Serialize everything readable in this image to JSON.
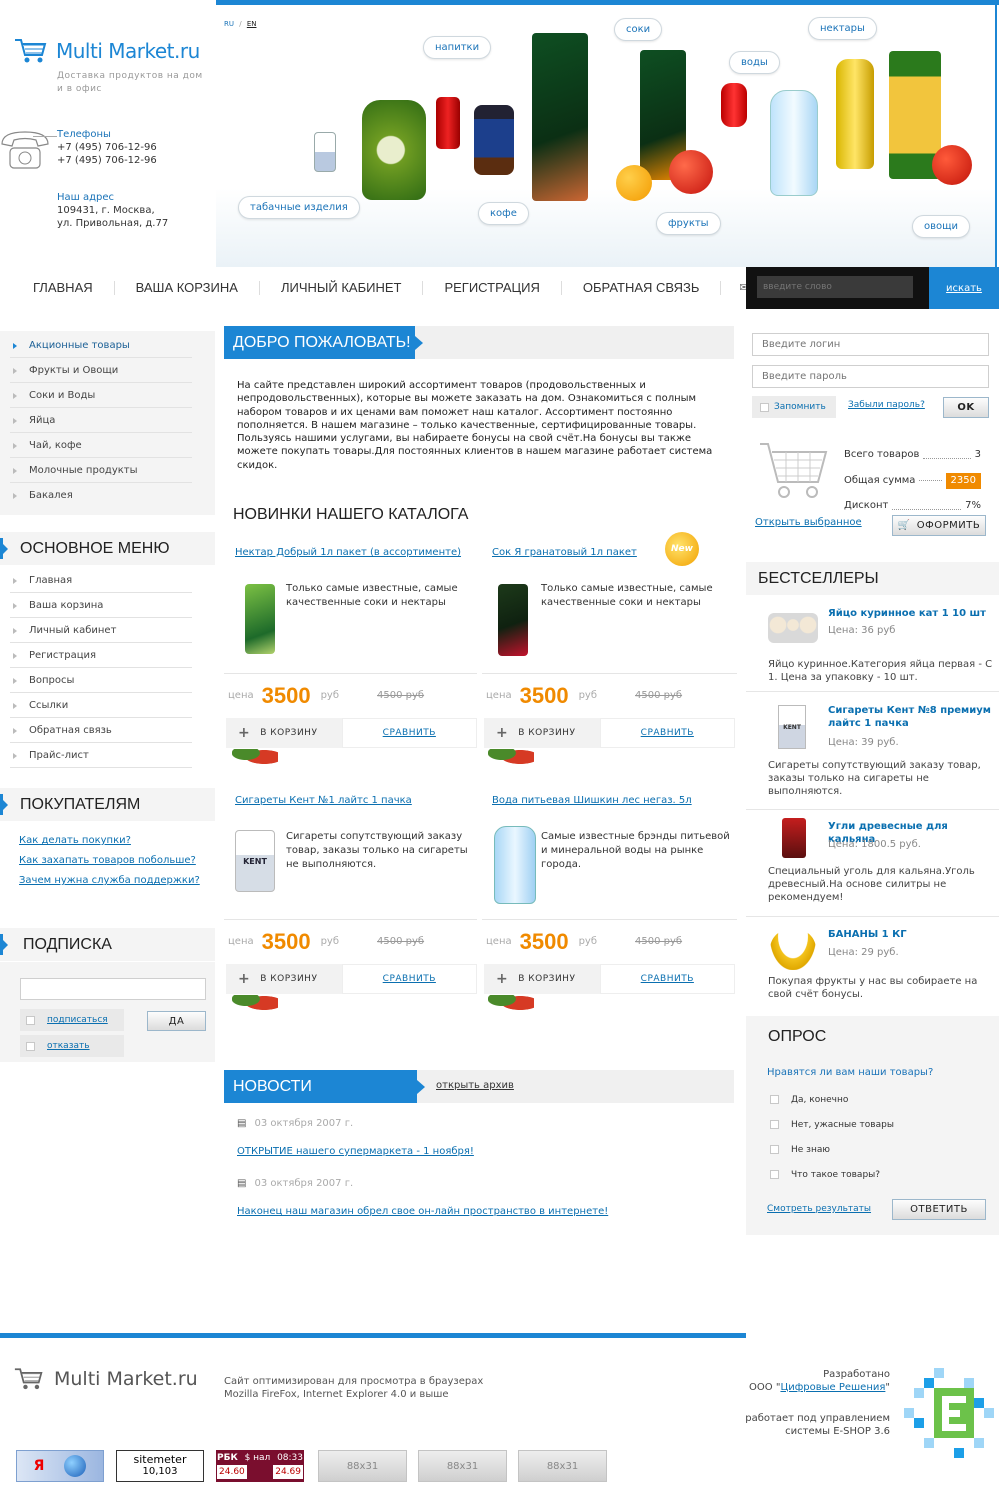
{
  "header": {
    "logo_text": "Multi Market.ru",
    "tagline": "Доставка продуктов на дом и в офис",
    "lang_ru": "RU",
    "lang_sep": "/",
    "lang_en": "EN",
    "phones_label": "Телефоны",
    "phone1": "+7 (495) 706-12-96",
    "phone2": "+7 (495) 706-12-96",
    "address_label": "Наш адрес",
    "address_line1": "109431, г. Москва,",
    "address_line2": "ул. Привольная, д.77"
  },
  "hero": {
    "labels": [
      "напитки",
      "соки",
      "воды",
      "нектары",
      "табачные изделия",
      "кофе",
      "фрукты",
      "овощи"
    ]
  },
  "nav": {
    "items": [
      "Главная",
      "Ваша корзина",
      "Личный кабинет",
      "Регистрация",
      "Обратная связь"
    ]
  },
  "search": {
    "placeholder": "введите слово",
    "button": "искать"
  },
  "promo_menu": {
    "items": [
      "Акционные товары",
      "Фрукты и Овощи",
      "Соки и Воды",
      "Яйца",
      "Чай, кофе",
      "Молочные продукты",
      "Бакалея"
    ]
  },
  "main_menu": {
    "title": "Основное меню",
    "items": [
      "Главная",
      "Ваша корзина",
      "Личный кабинет",
      "Регистрация",
      "Вопросы",
      "Ссылки",
      "Обратная связь",
      "Прайс-лист"
    ]
  },
  "buyers": {
    "title": "Покупателям",
    "links": [
      "Как делать покупки?",
      "Как захапать товаров побольше?",
      "Зачем нужна служба поддержки?"
    ]
  },
  "subscribe": {
    "title": "Подписка",
    "subscribe_label": "подписаться",
    "unsubscribe_label": "отказать",
    "button": "ДА"
  },
  "welcome": {
    "title": "Добро пожаловать!",
    "text": "На сайте представлен широкий ассортимент товаров (продовольственных и непродовольственных), которые вы можете заказать на дом. Ознакомиться с полным набором товаров и их ценами вам поможет наш каталог. Ассортимент постоянно пополняется. В нашем магазине – только качественные, сертифицированные товары. Пользуясь нашими услугами, вы набираете бонусы на свой счёт.На бонусы вы также можете покупать товары.Для постоянных клиентов в нашем магазине работает система скидок."
  },
  "catalog": {
    "title": "Новинки нашего каталога",
    "new_badge": "New",
    "price_label": "цена",
    "currency": "руб",
    "cart_label": "В КОРЗИНУ",
    "compare_label": "СРАВНИТЬ",
    "products": [
      {
        "name": "Нектар Добрый 1л пакет (в ассортименте)",
        "desc": "Только самые известные, самые качественные соки и нектары",
        "price": "3500",
        "old_price": "4500 руб"
      },
      {
        "name": "Сок Я гранатовый 1л пакет",
        "desc": "Только самые известные, самые качественные соки и нектары",
        "price": "3500",
        "old_price": "4500 руб"
      },
      {
        "name": "Сигареты Кент №1 лайтс 1 пачка",
        "desc": "Сигареты сопутствующий заказу товар, заказы только на сигареты не выполняются.",
        "price": "3500",
        "old_price": "4500 руб"
      },
      {
        "name": "Вода питьевая Шишкин лес негаз. 5л",
        "desc": "Самые известные брэнды питьевой и минеральной воды на рынке города.",
        "price": "3500",
        "old_price": "4500 руб"
      }
    ]
  },
  "news": {
    "title": "Новости",
    "archive_link": "открыть архив",
    "items": [
      {
        "date": "03 октября 2007 г.",
        "title": "ОТКРЫТИЕ нашего супермаркета - 1 ноября!"
      },
      {
        "date": "03 октября 2007 г.",
        "title": "Наконец наш магазин обрел свое он-лайн пространство в интернете!"
      }
    ]
  },
  "login": {
    "login_placeholder": "Введите логин",
    "password_placeholder": "Введите пароль",
    "remember_label": "Запомнить",
    "forgot_link": "Забыли пароль?",
    "ok_button": "OK"
  },
  "cart": {
    "total_items_label": "Всего товаров",
    "total_items_value": "3",
    "total_sum_label": "Общая сумма",
    "total_sum_value": "2350",
    "discount_label": "Дисконт",
    "discount_value": "7%",
    "open_link": "Открыть выбранное",
    "checkout_button": "ОФОРМИТЬ",
    "accent_color": "#f08a00"
  },
  "bestsellers": {
    "title": "Бестселлеры",
    "items": [
      {
        "name": "Яйцо куринное кат 1 10 шт",
        "price": "Цена: 36 руб",
        "desc": "Яйцо куринное.Категория яйца первая - С 1. Цена за упаковку - 10 шт."
      },
      {
        "name": "Сигареты Кент №8 премиум лайтс 1 пачка",
        "price": "Цена: 39 руб.",
        "desc": "Сигареты сопутствующий заказу товар, заказы только на сигареты не выполняются."
      },
      {
        "name": "Угли древесные для кальяна",
        "price": "Цена: 1800.5 руб.",
        "desc": "Специальный уголь для кальяна.Уголь древесный.На основе силитры не рекомендуем!"
      },
      {
        "name": "БАНАНЫ 1 КГ",
        "price": "Цена: 29 руб.",
        "desc": "Покупая фрукты у нас вы собираете на свой счёт бонусы."
      }
    ]
  },
  "poll": {
    "title": "Опрос",
    "question": "Нравятся ли вам наши товары?",
    "options": [
      "Да, конечно",
      "Нет, ужасные товары",
      "Не знаю",
      "Что такое товары?"
    ],
    "results_link": "Смотреть результаты",
    "answer_button": "ОТВЕТИТЬ"
  },
  "footer": {
    "logo_text": "Multi Market.ru",
    "browser_note_1": "Сайт оптимизирован для просмотра в браузерах",
    "browser_note_2": "Mozilla FireFox, Internet Explorer 4.0 и выше",
    "dev_line1": "Разработано",
    "dev_company_prefix": "ООО \"",
    "dev_company": "Цифровые Решения",
    "dev_company_suffix": "\"",
    "cms_line1": "работает под управлением",
    "cms_line2": "системы  E-SHOP 3.6",
    "sitemeter_label": "sitemeter",
    "sitemeter_count": "10,103",
    "rbc_label": "РБК",
    "rbc_usd": "$ нал",
    "rbc_time": "08:33",
    "rbc_buy": "24.60",
    "rbc_sell": "24.69",
    "banner_stub": "88x31",
    "yandex_letter": "Я"
  }
}
